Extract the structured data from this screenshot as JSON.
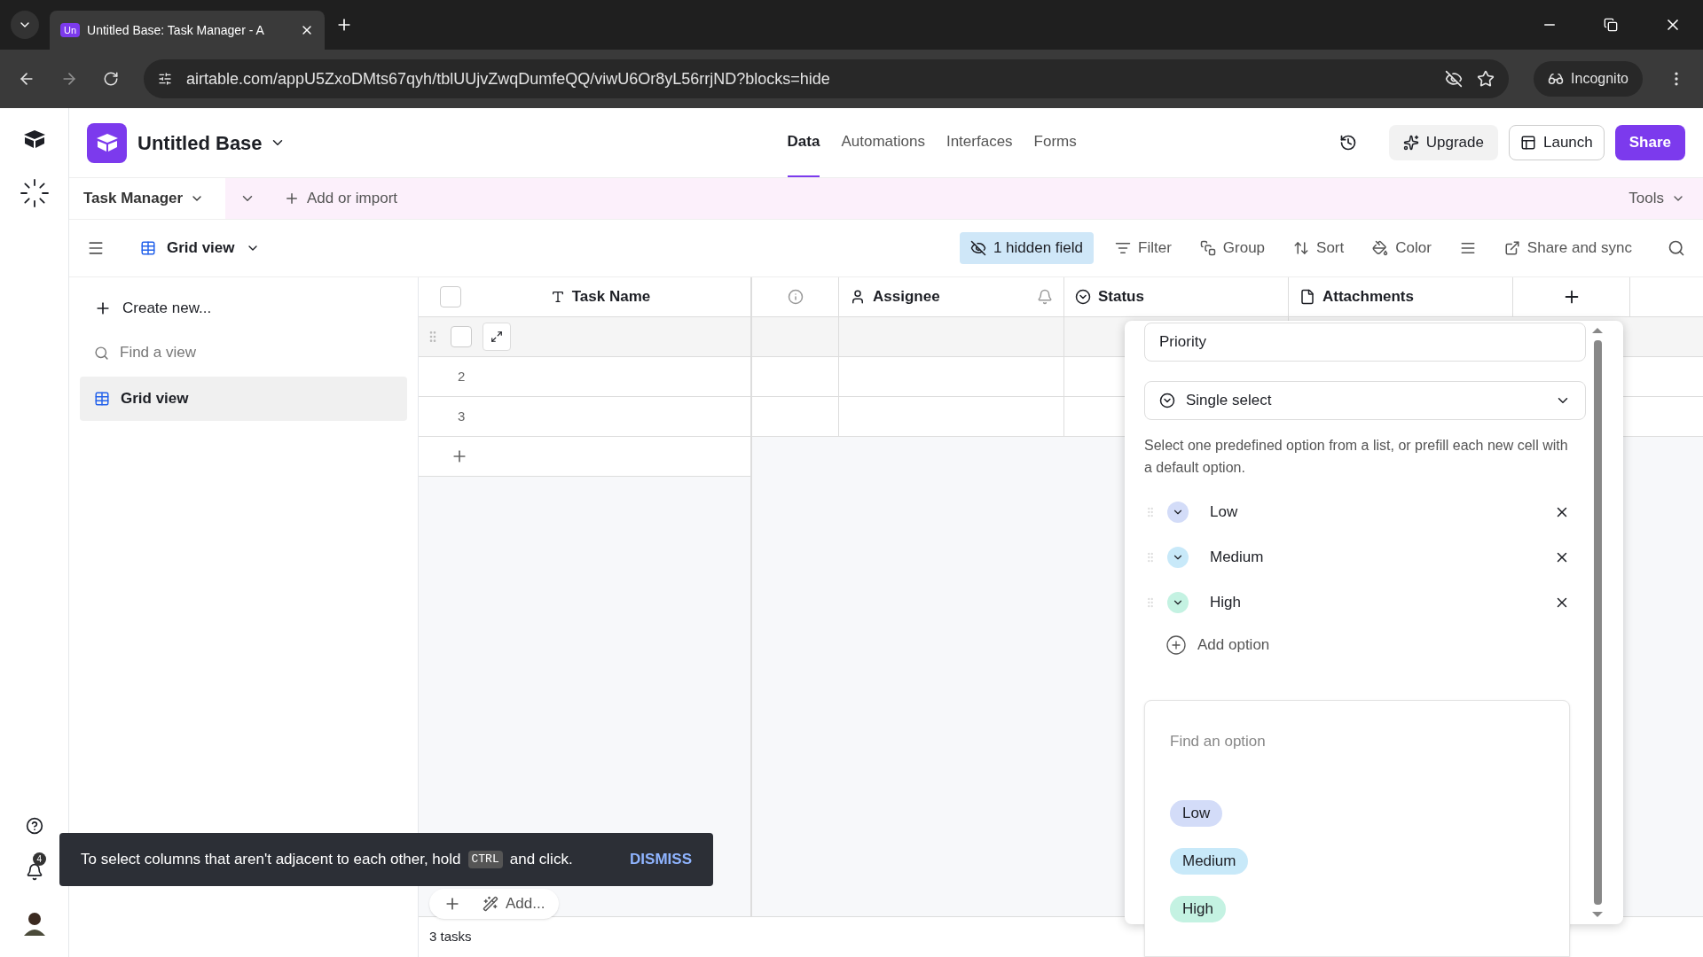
{
  "browser": {
    "tab": {
      "favicon": "Un",
      "title": "Untitled Base: Task Manager - A"
    },
    "url": "airtable.com/appU5ZxoDMts67qyh/tblUUjvZwqDumfeQQ/viwU6Or8yL56rrjND?blocks=hide",
    "profile": "Incognito"
  },
  "header": {
    "base_name": "Untitled Base",
    "nav": [
      {
        "label": "Data",
        "selected": true
      },
      {
        "label": "Automations",
        "selected": false
      },
      {
        "label": "Interfaces",
        "selected": false
      },
      {
        "label": "Forms",
        "selected": false
      }
    ],
    "upgrade": "Upgrade",
    "launch": "Launch",
    "share": "Share"
  },
  "table_bar": {
    "table": "Task Manager",
    "add": "Add or import",
    "tools": "Tools"
  },
  "toolbar": {
    "view": "Grid view",
    "items": [
      {
        "kind": "hidden",
        "label": "1 hidden field"
      },
      {
        "kind": "filter",
        "label": "Filter"
      },
      {
        "kind": "group",
        "label": "Group"
      },
      {
        "kind": "sort",
        "label": "Sort"
      },
      {
        "kind": "color",
        "label": "Color"
      },
      {
        "kind": "height"
      },
      {
        "kind": "share",
        "label": "Share and sync"
      }
    ]
  },
  "sidebar": {
    "create": "Create new...",
    "search_placeholder": "Find a view",
    "views": [
      {
        "label": "Grid view",
        "selected": true
      }
    ]
  },
  "grid": {
    "select_all": {
      "checked": false
    },
    "columns": [
      {
        "kind": "text",
        "label": "Task Name"
      },
      {
        "kind": "info"
      },
      {
        "kind": "user",
        "label": "Assignee"
      },
      {
        "kind": "select",
        "label": "Status"
      },
      {
        "kind": "file",
        "label": "Attachments"
      }
    ],
    "rows": [
      {
        "kind": "hover",
        "checked": false
      },
      {
        "kind": "number",
        "number": "2"
      },
      {
        "kind": "number",
        "number": "3"
      }
    ],
    "add_button": "Add...",
    "footer": "3 tasks"
  },
  "field_panel": {
    "name": "Priority",
    "type": "Single select",
    "description": "Select one predefined option from a list, or prefill each new cell with a default option.",
    "options": [
      {
        "label": "Low",
        "color": "#d3dcf8"
      },
      {
        "label": "Medium",
        "color": "#c8e9f9"
      },
      {
        "label": "High",
        "color": "#c4f2e2"
      }
    ],
    "add_option": "Add option"
  },
  "option_dropdown": {
    "placeholder": "Find an option",
    "options": [
      {
        "label": "Low",
        "color": "#d3dcf8"
      },
      {
        "label": "Medium",
        "color": "#c8e9f9"
      },
      {
        "label": "High",
        "color": "#c4f2e2"
      }
    ]
  },
  "toast": {
    "before": "To select columns that aren't adjacent to each other, hold",
    "key": "CTRL",
    "after": "and click.",
    "action": "DISMISS"
  },
  "rail": {
    "notifications": "4"
  }
}
